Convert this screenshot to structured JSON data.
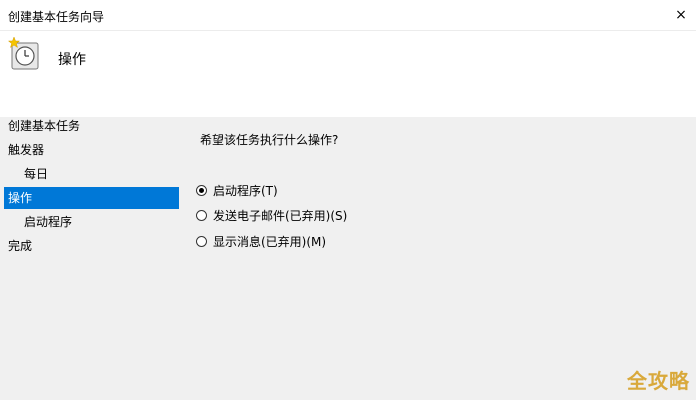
{
  "window": {
    "title": "创建基本任务向导",
    "close_icon": "×"
  },
  "header": {
    "icon": "clock-task-icon",
    "heading": "操作"
  },
  "sidebar": {
    "items": [
      {
        "label": "创建基本任务",
        "selected": false,
        "sub": false
      },
      {
        "label": "触发器",
        "selected": false,
        "sub": false
      },
      {
        "label": "每日",
        "selected": false,
        "sub": true
      },
      {
        "label": "操作",
        "selected": true,
        "sub": false
      },
      {
        "label": "启动程序",
        "selected": false,
        "sub": true
      },
      {
        "label": "完成",
        "selected": false,
        "sub": false
      }
    ]
  },
  "main": {
    "prompt": "希望该任务执行什么操作?",
    "options": [
      {
        "label": "启动程序(T)",
        "checked": true
      },
      {
        "label": "发送电子邮件(已弃用)(S)",
        "checked": false
      },
      {
        "label": "显示消息(已弃用)(M)",
        "checked": false
      }
    ]
  },
  "watermark": "全攻略",
  "colors": {
    "accent": "#0078d7",
    "panel": "#f0f0f0"
  }
}
